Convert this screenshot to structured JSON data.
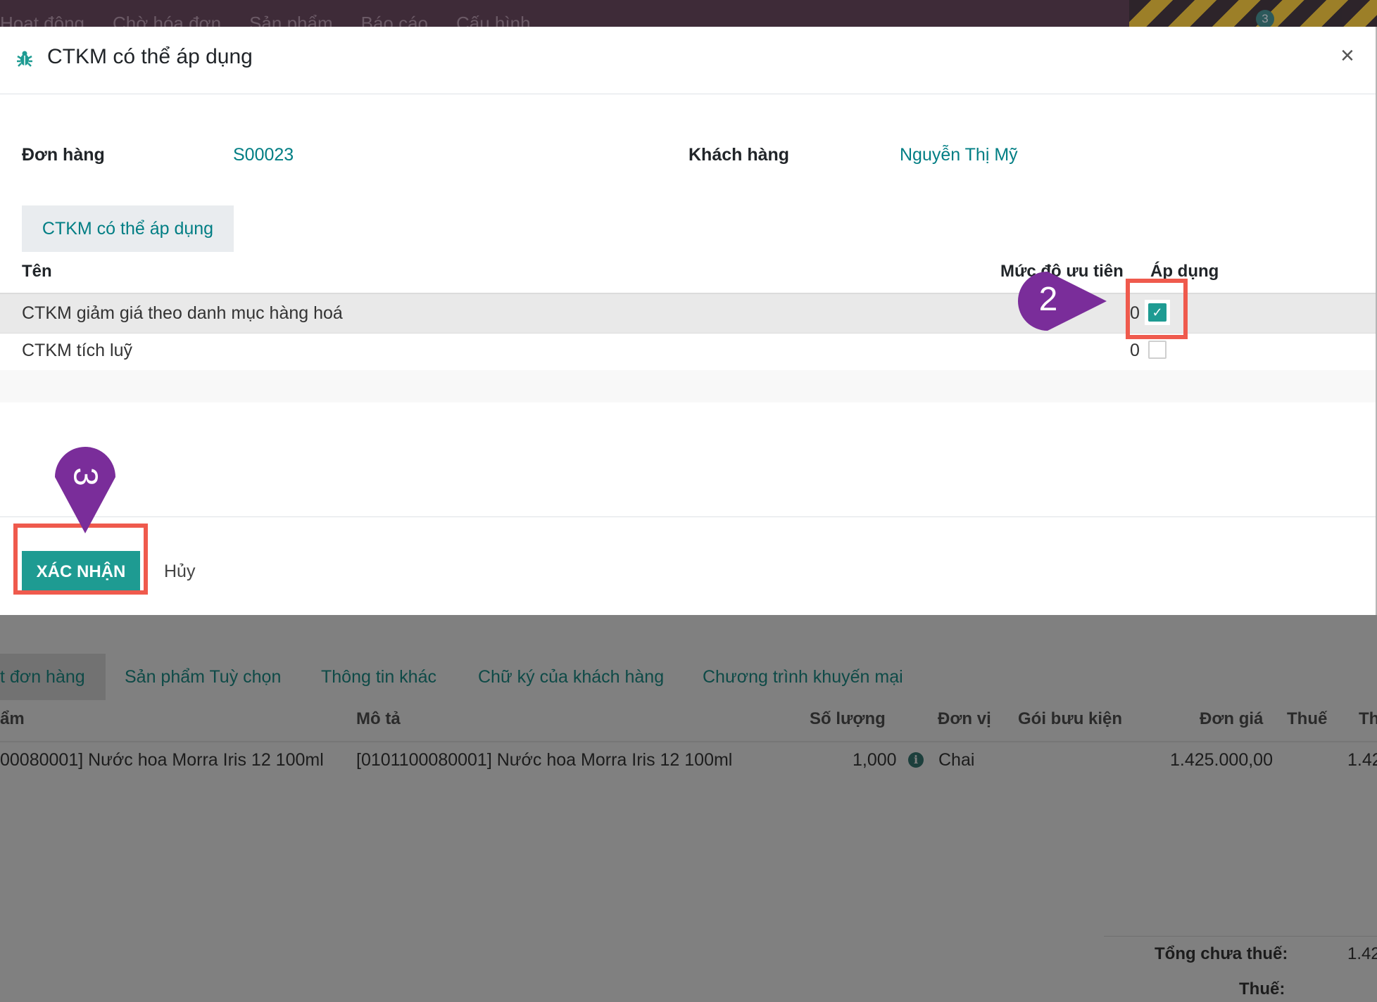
{
  "app": {
    "nav": [
      "Hoạt động",
      "Chờ hóa đơn",
      "Sản phẩm",
      "Báo cáo",
      "Cấu hình"
    ],
    "messages_badge": "3"
  },
  "modal": {
    "title": "CTKM có thể áp dụng",
    "fields": {
      "order_label": "Đơn hàng",
      "order_value": "S00023",
      "customer_label": "Khách hàng",
      "customer_value": "Nguyễn Thị Mỹ"
    },
    "tab_label": "CTKM có thể áp dụng",
    "columns": {
      "name": "Tên",
      "priority": "Mức độ ưu tiên",
      "apply": "Áp dụng"
    },
    "rows": [
      {
        "name": "CTKM giảm giá theo danh mục hàng hoá",
        "priority": "0",
        "applied": true
      },
      {
        "name": "CTKM tích luỹ",
        "priority": "0",
        "applied": false
      }
    ],
    "confirm_label": "XÁC NHẬN",
    "cancel_label": "Hủy"
  },
  "annotations": {
    "step2": "2",
    "step3": "3",
    "highlight_color": "#ef5a4d",
    "marker_color": "#7a2d9a"
  },
  "background": {
    "tabs": [
      "t đơn hàng",
      "Sản phẩm Tuỳ chọn",
      "Thông tin khác",
      "Chữ ký của khách hàng",
      "Chương trình khuyến mại"
    ],
    "columns": [
      "ẩm",
      "Mô tả",
      "Số lượng",
      "Đơn vị",
      "Gói bưu kiện",
      "Đơn giá",
      "Thuế",
      "Th"
    ],
    "line": {
      "product": "00080001] Nước hoa Morra Iris 12 100ml",
      "description": "[0101100080001] Nước hoa Morra Iris 12 100ml",
      "quantity": "1,000",
      "uom": "Chai",
      "unit_price": "1.425.000,00",
      "subtotal": "1.42"
    },
    "totals": {
      "untaxed_label": "Tổng chưa thuế:",
      "untaxed_value": "1.42",
      "tax_label": "Thuế:"
    }
  }
}
